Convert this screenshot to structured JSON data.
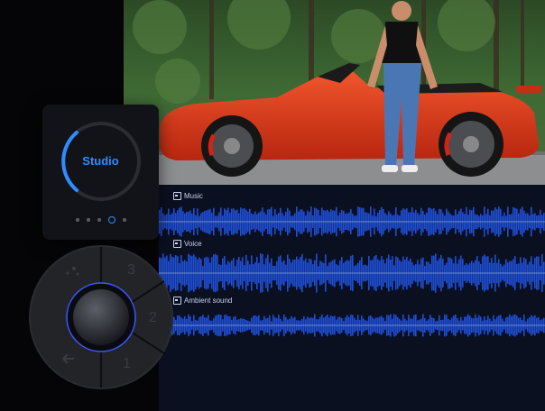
{
  "photo": {
    "subject": "red-convertible-sports-car-with-man"
  },
  "tracks": [
    {
      "label": "Music"
    },
    {
      "label": "Voice"
    },
    {
      "label": "Ambient sound"
    }
  ],
  "mode_card": {
    "mode_label": "Studio",
    "pager": {
      "count": 5,
      "active_index": 3
    }
  },
  "dial": {
    "segments": [
      "3",
      "2",
      "1"
    ],
    "icons": [
      "sparkle-icon",
      "undo-icon"
    ]
  },
  "colors": {
    "accent": "#2f8cff",
    "waveform": "#1f4fd8",
    "car": "#d93a1c"
  }
}
